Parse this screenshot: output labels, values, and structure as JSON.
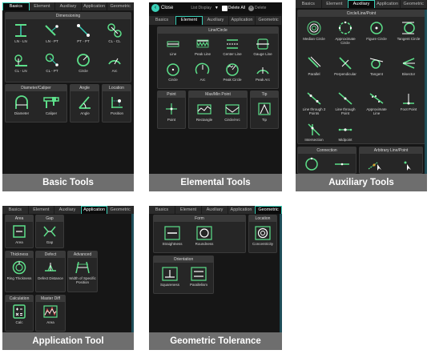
{
  "colors": {
    "accent": "#3ad0b8",
    "icon": "#5de08a",
    "panel": "#161616",
    "caption": "#6e6e6e"
  },
  "captions": {
    "basic": "Basic Tools",
    "elemental": "Elemental Tools",
    "auxiliary": "Auxiliary Tools",
    "application": "Application Tool",
    "geometric": "Geometric Tolerance"
  },
  "tabs": [
    "Basics",
    "Element",
    "Auxiliary",
    "Application",
    "Geometric"
  ],
  "basic": {
    "groups": {
      "dimensioning": "Dimensioning",
      "diameter": "Diameter/Caliper",
      "angle": "Angle",
      "location": "Location"
    },
    "tools": [
      "LN - LN",
      "LN - PT",
      "PT - PT",
      "CL - CL",
      "CL - LN",
      "CL - PT",
      "Circle",
      "Arc",
      "Diameter",
      "Caliper",
      "Angle",
      "Position"
    ]
  },
  "elemental": {
    "toolbar": {
      "close": "Close",
      "list_display": "List Display",
      "delete_all": "Delete All",
      "delete": "Delete"
    },
    "groups": {
      "line_circle": "Line/Circle",
      "point": "Point",
      "maxmin": "Max/Min Point",
      "tip": "Tip"
    },
    "tools": [
      "Line",
      "Peak Line",
      "Center Line",
      "Gauge Line",
      "Circle",
      "Arc",
      "Peak Circle",
      "Peak Arc",
      "Point",
      "Rectangle",
      "Circle/Arc",
      "Tip"
    ]
  },
  "auxiliary": {
    "groups": {
      "circle_line_point": "Circle/Line/Point",
      "connection": "Connection",
      "arbitrary": "Arbitrary Line/Point"
    },
    "tools": [
      "Median Circle",
      "Approximate Circle",
      "Figure Circle",
      "Tangent Circle",
      "Parallel",
      "Perpendicular",
      "Tangent",
      "Bisector",
      "Line through 2 Points",
      "Line through Point",
      "Approximate Line",
      "Foot Point",
      "Intersection",
      "Midpoint"
    ]
  },
  "application": {
    "groups": {
      "area": "Area",
      "gap": "Gap",
      "thickness": "Thickness",
      "defect": "Defect",
      "advanced": "Advanced",
      "calculation": "Calculation",
      "master_diff": "Master Diff"
    },
    "tools": [
      "Area",
      "Gap",
      "Ring Thickness",
      "Defect Distance",
      "Width of Specific Position",
      "Calc",
      "Area"
    ]
  },
  "geometric": {
    "groups": {
      "form": "Form",
      "location": "Location",
      "orientation": "Orientation"
    },
    "tools": [
      "Straightness",
      "Roundness",
      "Concentricity",
      "Squareness",
      "Parallelism"
    ]
  }
}
